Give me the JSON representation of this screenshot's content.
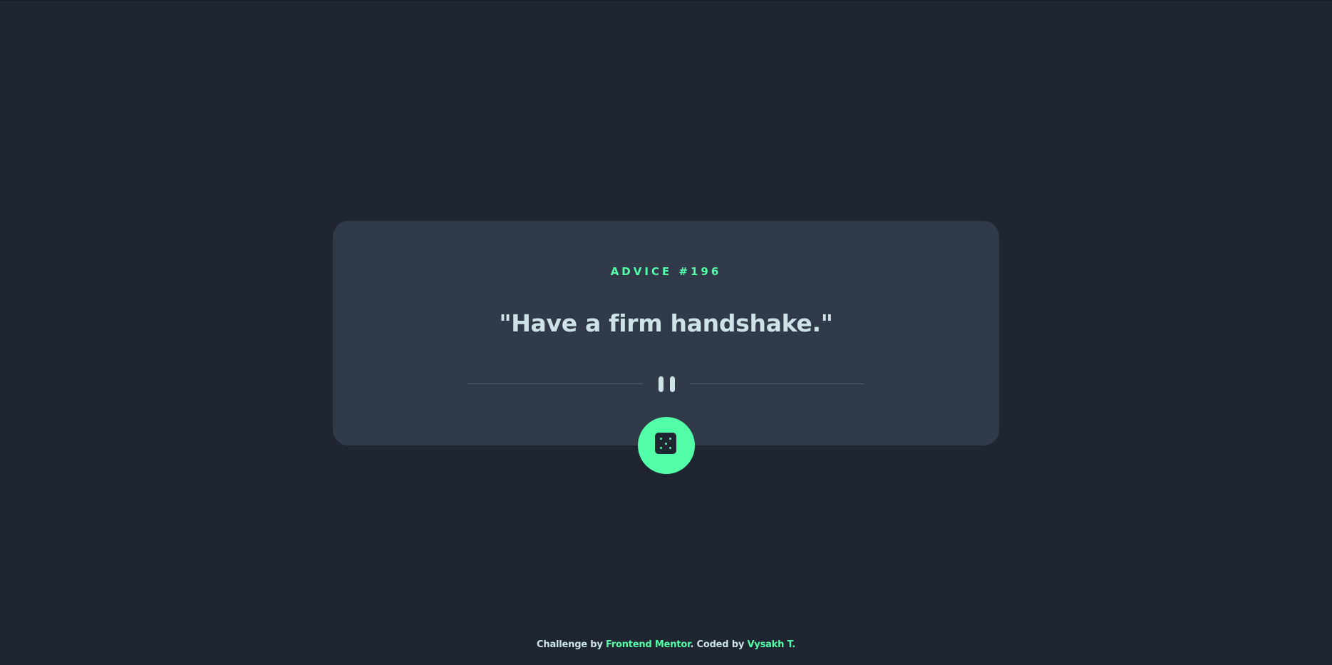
{
  "card": {
    "advice_label": "ADVICE #196",
    "quote": "\"Have a firm handshake.\""
  },
  "divider": {
    "icon": "pause-icon"
  },
  "button": {
    "icon": "dice-icon"
  },
  "footer": {
    "prefix": "Challenge by ",
    "link1": "Frontend Mentor",
    "middle": ". Coded by ",
    "link2": "Vysakh T",
    "suffix": "."
  },
  "colors": {
    "background": "#1f2632",
    "card": "#313a48",
    "accent": "#52ffa8",
    "text": "#cee3e9",
    "divider": "#4f5d74"
  }
}
